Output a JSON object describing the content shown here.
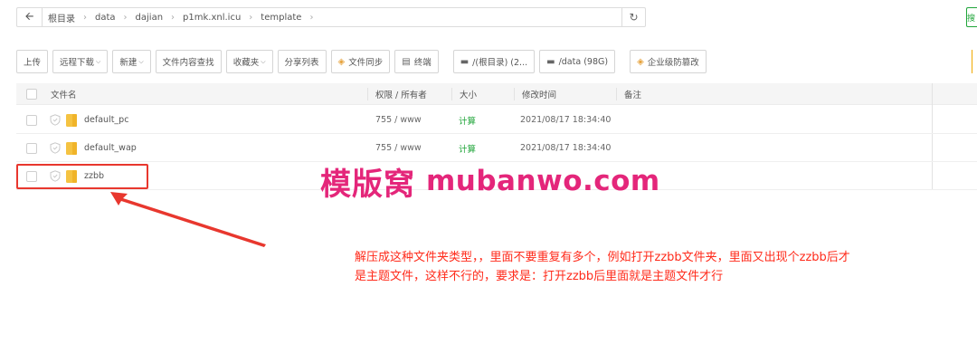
{
  "breadcrumb": {
    "back_icon": "arrow-left-icon",
    "items": [
      "根目录",
      "data",
      "dajian",
      "p1mk.xnl.icu",
      "template"
    ],
    "refresh_icon": "refresh-icon",
    "edge_button_label": "搜"
  },
  "toolbar": {
    "upload": "上传",
    "remote_download": "远程下载",
    "new": "新建",
    "content_search": "文件内容查找",
    "favorites": "收藏夹",
    "share_list": "分享列表",
    "file_sync": "文件同步",
    "terminal": "终端",
    "disk_root": "/(根目录) (2...",
    "disk_data": "/data (98G)",
    "enterprise_protect": "企业级防篡改"
  },
  "table": {
    "headers": {
      "name": "文件名",
      "perm": "权限 / 所有者",
      "size": "大小",
      "time": "修改时间",
      "note": "备注"
    },
    "rows": [
      {
        "name": "default_pc",
        "perm": "755 / www",
        "size": "计算",
        "time": "2021/08/17 18:34:40"
      },
      {
        "name": "default_wap",
        "perm": "755 / www",
        "size": "计算",
        "time": "2021/08/17 18:34:40"
      },
      {
        "name": "zzbb",
        "perm": "",
        "size": "",
        "time": ""
      }
    ]
  },
  "watermark": {
    "cn": "模版窝",
    "en": "mubanwo.com"
  },
  "annotation": {
    "line1": "解压成这种文件夹类型，，里面不要重复有多个，例如打开zzbb文件夹，里面又出现个zzbb后才",
    "line2": "是主题文件，这样不行的，要求是：打开zzbb后里面就是主题文件才行"
  },
  "colors": {
    "accent_green": "#20a53a",
    "folder_yellow": "#f5c342",
    "highlight_red": "#e8372e",
    "watermark_pink": "#e4267a",
    "annotation_red": "#ff2a1a"
  }
}
